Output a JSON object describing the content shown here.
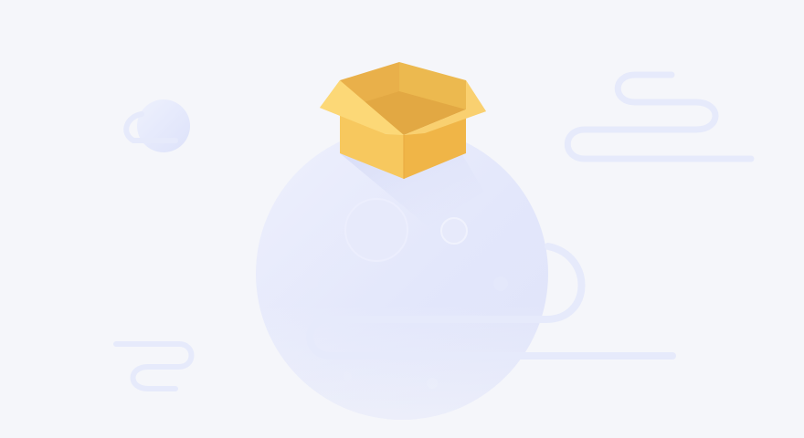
{
  "illustration": {
    "kind": "empty-state",
    "icons": [
      "empty-box-icon",
      "moon-icon",
      "small-planet-icon",
      "wind-cloud-icon"
    ],
    "colors": {
      "background": "#f5f6fa",
      "moon_light": "#eef0fc",
      "moon_dark": "#dfe3fa",
      "crater": "#e6e9fb",
      "wind": "#e6eafb",
      "box_front": "#f7c85e",
      "box_side": "#f0b547",
      "box_flap_light": "#fbd97f",
      "box_flap_dark": "#e9b04a",
      "box_shadow": "#d9ddf6"
    }
  }
}
